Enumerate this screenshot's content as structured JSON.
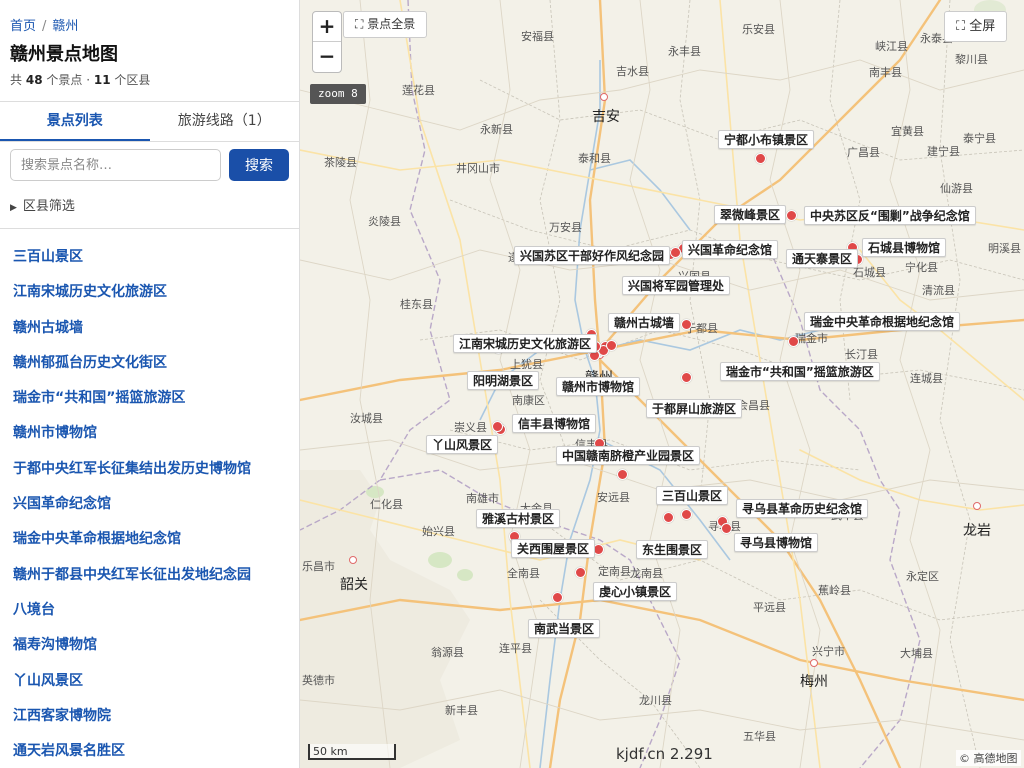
{
  "breadcrumb": {
    "home": "首页",
    "separator": "/",
    "current": "赣州"
  },
  "page_title": "赣州景点地图",
  "stats": {
    "prefix": "共",
    "spots_count": "48",
    "spots_unit": "个景点 ·",
    "districts_count": "11",
    "districts_unit": "个区县"
  },
  "tabs": [
    {
      "label": "景点列表"
    },
    {
      "label": "旅游线路（1）"
    }
  ],
  "search": {
    "placeholder": "搜索景点名称…",
    "button": "搜索"
  },
  "filter": {
    "label": "区县筛选"
  },
  "spot_list": [
    "三百山景区",
    "江南宋城历史文化旅游区",
    "赣州古城墙",
    "赣州郁孤台历史文化街区",
    "瑞金市“共和国”摇篮旅游区",
    "赣州市博物馆",
    "于都中央红军长征集结出发历史博物馆",
    "兴国革命纪念馆",
    "瑞金中央革命根据地纪念馆",
    "赣州于都县中央红军长征出发地纪念园",
    "八境台",
    "福寿沟博物馆",
    "丫山风景区",
    "江西客家博物院",
    "通天岩风景名胜区"
  ],
  "map": {
    "zoom_in": "+",
    "zoom_out": "−",
    "overview_button": "全景点全景",
    "overview_label": "景点全景",
    "fullscreen_label": "全屏",
    "zoom_badge": "zoom 8",
    "scale_label": "50 km",
    "watermark": "kjdf.cn 2.291",
    "attribution": "© 高德地图",
    "icons": {
      "overview": "expand-icon",
      "fullscreen": "fullscreen-icon"
    },
    "colors": {
      "marker": "#e04848",
      "accent": "#1a4fa8"
    },
    "spot_labels": [
      "宁都小布镇景区",
      "翠微峰景区",
      "中央苏区反“围剿”战争纪念馆",
      "石城县博物馆",
      "兴国苏区干部好作风纪念园",
      "兴国革命纪念馆",
      "通天寨景区",
      "兴国将军园管理处",
      "赣州古城墙",
      "瑞金中央革命根据地纪念馆",
      "江南宋城历史文化旅游区",
      "阳明湖景区",
      "赣州市博物馆",
      "瑞金市“共和国”摇篮旅游区",
      "于都屏山旅游区",
      "信丰县博物馆",
      "丫山风景区",
      "中国赣南脐橙产业园景区",
      "三百山景区",
      "寻乌县革命历史纪念馆",
      "雅溪古村景区",
      "寻乌县博物馆",
      "关西围屋景区",
      "东生围景区",
      "虔心小镇景区",
      "南武当景区"
    ],
    "city_labels": [
      "安福县",
      "永丰县",
      "乐安县",
      "吉水县",
      "南丰县",
      "黎川县",
      "莲花县",
      "吉安",
      "永新县",
      "宜黄县",
      "泰宁县",
      "茶陵县",
      "井冈山市",
      "泰和县",
      "广昌县",
      "建宁县",
      "炎陵县",
      "万安县",
      "宁化县",
      "明溪县",
      "遂川县",
      "清流县",
      "桂东县",
      "赣州",
      "长汀县",
      "连城县",
      "上犹县",
      "汝城县",
      "会昌县",
      "崇义县",
      "信丰县",
      "南雄市",
      "仁化县",
      "始兴县",
      "安远县",
      "武平县",
      "寻乌县",
      "龙岩",
      "全南县",
      "定南县",
      "乐昌市",
      "韶关",
      "蕉岭县",
      "平远县",
      "永定区",
      "龙南县",
      "翁源县",
      "连平县",
      "梅州",
      "大埔县",
      "英德市",
      "新丰县",
      "龙川县",
      "兴宁市",
      "五华县",
      "仁化",
      "于都县",
      "瑞金市",
      "石城县",
      "宁都县",
      "兴国县",
      "南康区",
      "大余县",
      "峡江县",
      "永泰县",
      "仙游县"
    ]
  }
}
